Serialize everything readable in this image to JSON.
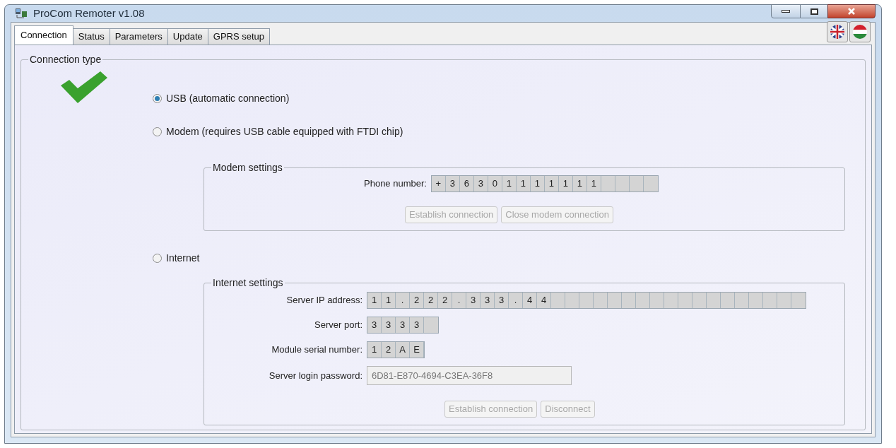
{
  "window": {
    "title": "ProCom Remoter v1.08"
  },
  "tabs": [
    {
      "label": "Connection",
      "selected": true
    },
    {
      "label": "Status",
      "selected": false
    },
    {
      "label": "Parameters",
      "selected": false
    },
    {
      "label": "Update",
      "selected": false
    },
    {
      "label": "GPRS setup",
      "selected": false
    }
  ],
  "connection_type": {
    "title": "Connection type",
    "connected": true,
    "options": [
      {
        "label": "USB (automatic connection)",
        "selected": true
      },
      {
        "label": "Modem (requires USB cable equipped with FTDI chip)",
        "selected": false
      },
      {
        "label": "Internet",
        "selected": false
      }
    ]
  },
  "modem_settings": {
    "title": "Modem settings",
    "phone_number": {
      "label": "Phone number:",
      "cells": [
        "+",
        "3",
        "6",
        "3",
        "0",
        "1",
        "1",
        "1",
        "1",
        "1",
        "1",
        "1"
      ]
    },
    "buttons": [
      {
        "label": "Establish connection",
        "disabled": true
      },
      {
        "label": "Close modem connection",
        "disabled": true
      }
    ]
  },
  "internet_settings": {
    "title": "Internet settings",
    "fields": [
      {
        "kind": "cells",
        "label": "Server IP address:",
        "cells": [
          "1",
          "1",
          ".",
          "2",
          "2",
          "2",
          ".",
          "3",
          "3",
          "3",
          ".",
          "4",
          "4"
        ]
      },
      {
        "kind": "cells",
        "label": "Server port:",
        "cells": [
          "3",
          "3",
          "3",
          "3"
        ]
      },
      {
        "kind": "cells",
        "label": "Module serial number:",
        "cells": [
          "1",
          "2",
          "A",
          "E"
        ]
      },
      {
        "kind": "text",
        "label": "Server login password:",
        "value": "6D81-E870-4694-C3EA-36F8"
      }
    ],
    "buttons": [
      {
        "label": "Establish connection",
        "disabled": true
      },
      {
        "label": "Disconnect",
        "disabled": true
      }
    ]
  }
}
